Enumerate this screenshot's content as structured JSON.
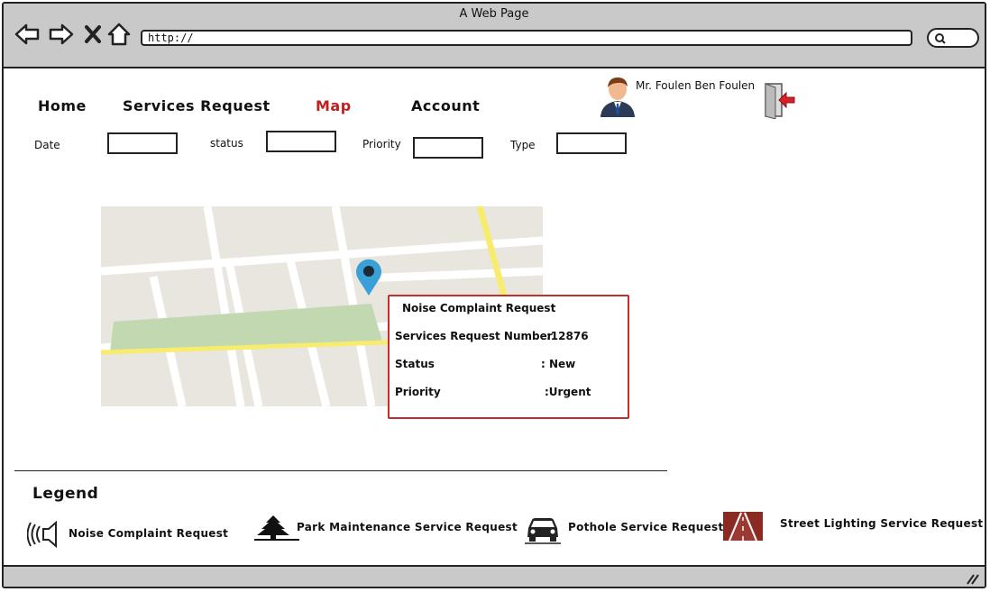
{
  "window": {
    "title": "A Web Page"
  },
  "browser": {
    "url": "http://"
  },
  "nav": {
    "home": "Home",
    "services": "Services Request",
    "map": "Map",
    "account": "Account"
  },
  "user": {
    "name": "Mr. Foulen Ben Foulen"
  },
  "filters": {
    "date": "Date",
    "status": "status",
    "priority": "Priority",
    "type": "Type"
  },
  "popup": {
    "title": "Noise Complaint Request",
    "number_label": "Services Request Number",
    "number_value": ":12876",
    "status_label": "Status",
    "status_value": ": New",
    "priority_label": "Priority",
    "priority_value": ":Urgent"
  },
  "legend": {
    "title": "Legend",
    "items": [
      {
        "label": "Noise Complaint Request",
        "icon": "speaker-icon"
      },
      {
        "label": "Park Maintenance Service Request",
        "icon": "tree-icon"
      },
      {
        "label": "Pothole Service Request",
        "icon": "car-icon"
      },
      {
        "label": "Street Lighting Service Request",
        "icon": "road-icon"
      }
    ]
  },
  "colors": {
    "active_nav": "#c0201f",
    "popup_border": "#c0302e",
    "pin": "#3aa0d8",
    "chrome": "#c9c9c9"
  }
}
